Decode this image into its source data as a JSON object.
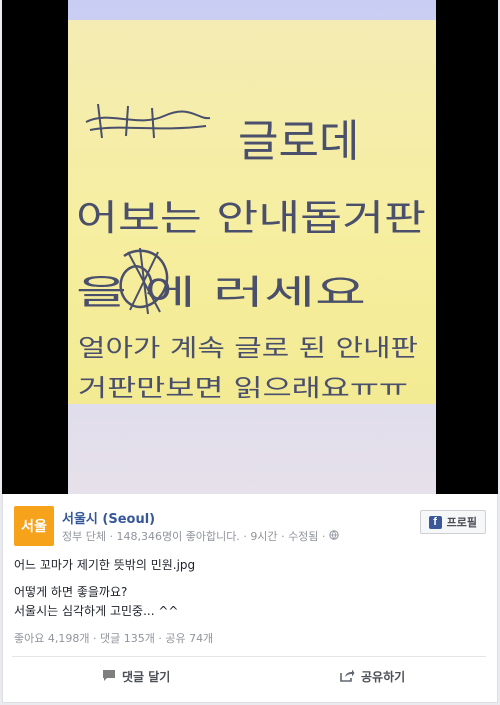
{
  "post": {
    "page_name": "서울시 (Seoul)",
    "avatar_text": "서울",
    "category": "정부 단체",
    "likes_text": "148,346명이 좋아합니다.",
    "time": "9시간",
    "edited": "수정됨",
    "profile_button": "프로필",
    "title_line": "어느 꼬마가 제기한 뜻밖의 민원.jpg",
    "body_line1": "어떻게 하면 좋을까요?",
    "body_line2": "서울시는 심각하게 고민중... ^^",
    "stats": {
      "likes": "좋아요 4,198개",
      "comments": "댓글 135개",
      "shares": "공유 74개"
    }
  },
  "note": {
    "line1": "글로데",
    "line2": "어보는 안내돕거판",
    "line3": "을 에 러세요",
    "line4": "얼아가 계속 글로 된 안내판",
    "line5": "거판만보면 읽으래요ㅠㅠ"
  },
  "actions": {
    "comment": "댓글 달기",
    "share": "공유하기"
  },
  "colors": {
    "link_blue": "#365899",
    "avatar_orange": "#f7a21b",
    "fb_blue": "#3b5998",
    "sticky_yellow": "#f5ec9f"
  },
  "icons": [
    "facebook-icon",
    "globe-icon",
    "comment-icon",
    "share-icon"
  ]
}
